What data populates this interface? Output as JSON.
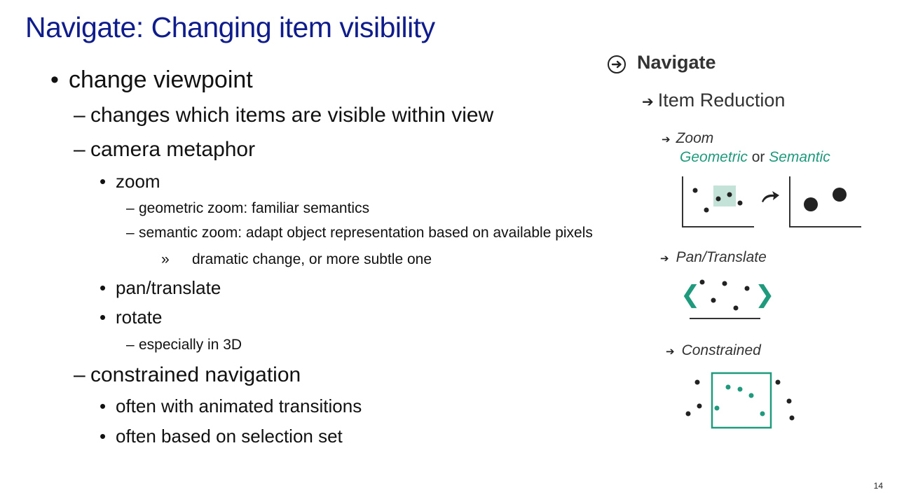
{
  "slide": {
    "title": "Navigate: Changing item visibility",
    "page_number": "14"
  },
  "bullets": [
    {
      "marker": "•",
      "text": "change viewpoint"
    },
    {
      "marker": "–",
      "text": "changes which items are visible within view"
    },
    {
      "marker": "–",
      "text": "camera metaphor"
    },
    {
      "marker": "•",
      "text": "zoom"
    },
    {
      "marker": "–",
      "text": "geometric zoom: familiar semantics"
    },
    {
      "marker": "–",
      "text": "semantic zoom: adapt object representation based on available pixels"
    },
    {
      "marker": "»",
      "text": "dramatic change, or more subtle one"
    },
    {
      "marker": "•",
      "text": "pan/translate"
    },
    {
      "marker": "•",
      "text": "rotate"
    },
    {
      "marker": "–",
      "text": "especially in 3D"
    },
    {
      "marker": "–",
      "text": "constrained navigation"
    },
    {
      "marker": "•",
      "text": "often with animated transitions"
    },
    {
      "marker": "•",
      "text": "often based on selection set"
    }
  ],
  "taxonomy": {
    "header": "Navigate",
    "header_icon": "circled-arrow-icon",
    "section": "Item Reduction",
    "zoom_label": "Zoom",
    "zoom_geometric": "Geometric",
    "zoom_or": "or",
    "zoom_semantic": "Semantic",
    "pan_label": "Pan/Translate",
    "constrained_label": "Constrained",
    "arrow_glyph": "➔",
    "pan_left_glyph": "❮",
    "pan_right_glyph": "❯"
  },
  "colors": {
    "title": "#0f1c8c",
    "accent": "#1f9a7c",
    "highlight": "#c5e2d8",
    "dark": "#222222"
  }
}
